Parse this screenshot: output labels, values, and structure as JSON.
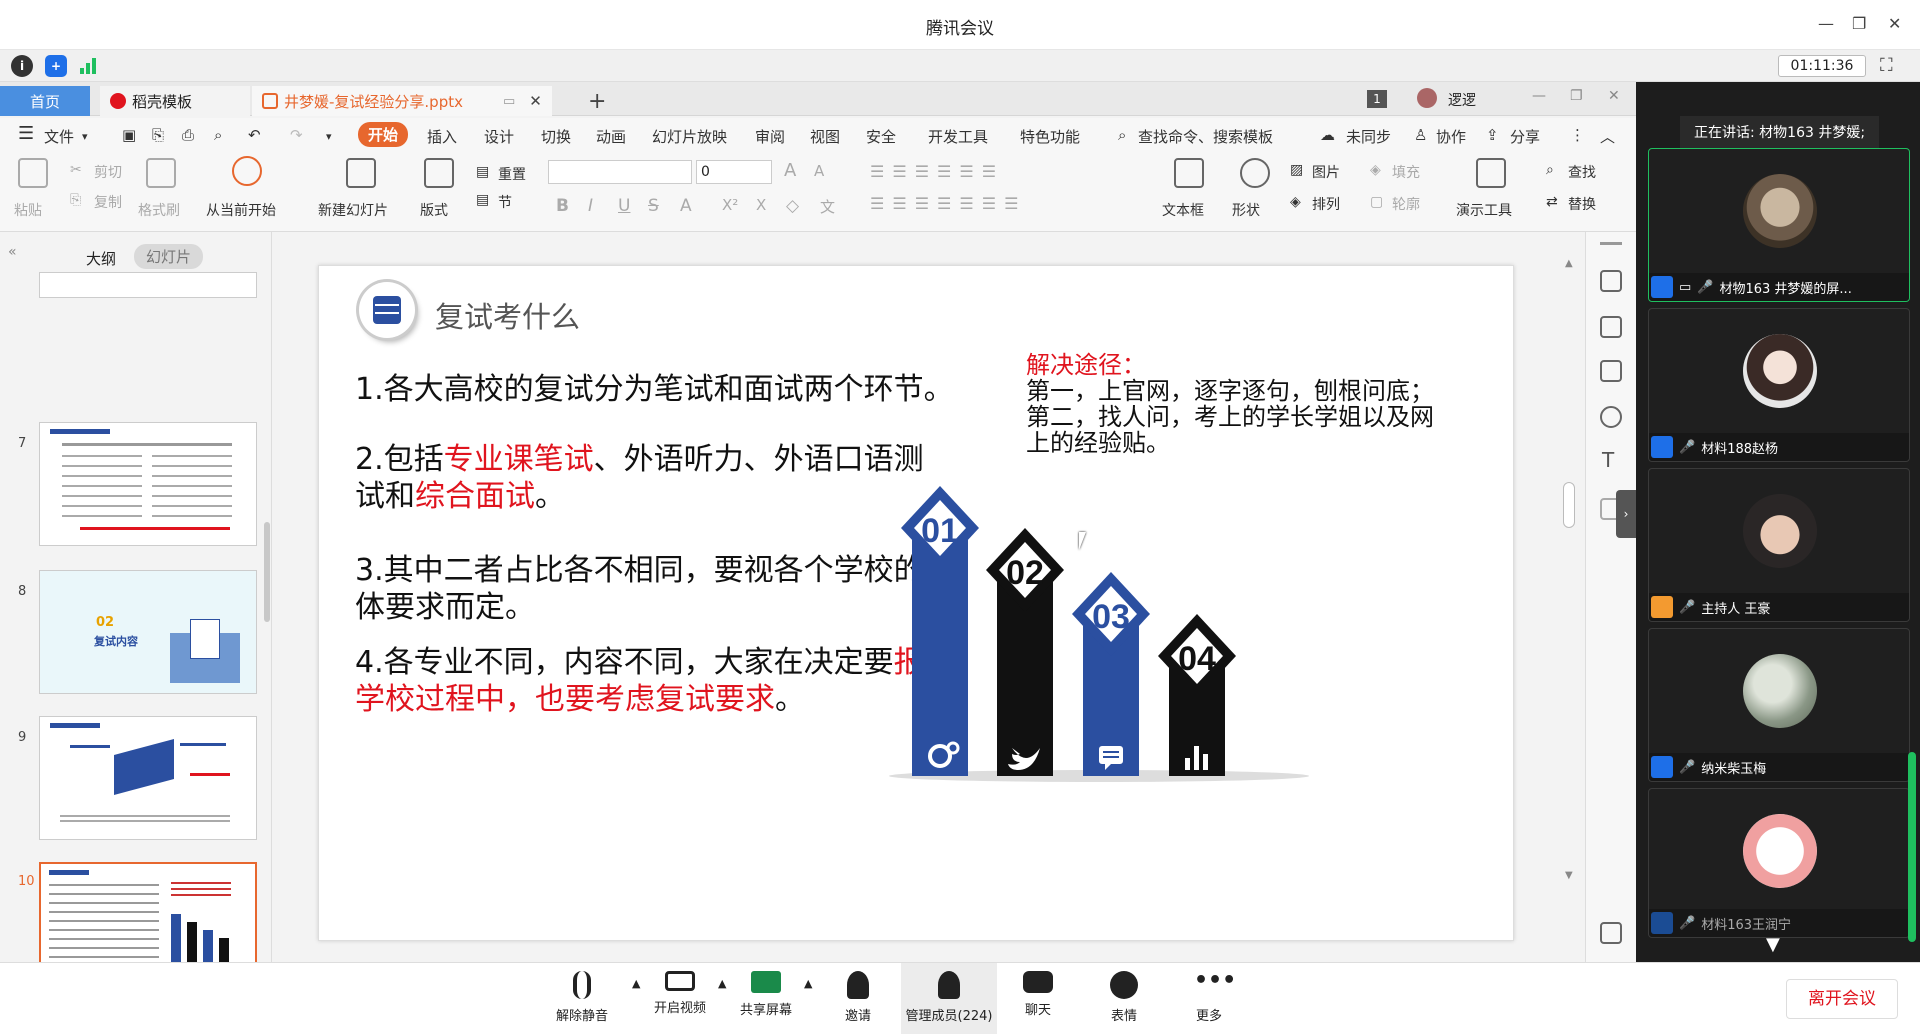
{
  "window": {
    "title": "腾讯会议",
    "timer": "01:11:36"
  },
  "wps_tabs": {
    "home": "首页",
    "daoke": "稻壳模板",
    "file": "井梦媛-复试经验分享.pptx",
    "add": "+",
    "badge": "1",
    "user": "逻逻"
  },
  "menu": {
    "file": "文件",
    "start": "开始",
    "insert": "插入",
    "design": "设计",
    "switch": "切换",
    "animation": "动画",
    "slideshow": "幻灯片放映",
    "review": "审阅",
    "view": "视图",
    "security": "安全",
    "devtools": "开发工具",
    "special": "特色功能",
    "search": "查找命令、搜索模板",
    "unsynced": "未同步",
    "collab": "协作",
    "share": "分享"
  },
  "ribbon": {
    "paste": "粘贴",
    "cut": "剪切",
    "copy": "复制",
    "format_painter": "格式刷",
    "play_from_current": "从当前开始",
    "new_slide": "新建幻灯片",
    "layout": "版式",
    "reset": "重置",
    "section": "节",
    "font_size": "0",
    "textbox": "文本框",
    "shape": "形状",
    "picture": "图片",
    "fill": "填充",
    "arrange": "排列",
    "outline": "轮廓",
    "present_tools": "演示工具",
    "find": "查找",
    "replace": "替换"
  },
  "leftpanel": {
    "outline_tab": "大纲",
    "slides_tab": "幻灯片",
    "thumbs": [
      {
        "num": "7"
      },
      {
        "num": "8"
      },
      {
        "num": "9"
      },
      {
        "num": "10"
      }
    ],
    "thumb8_num": "02",
    "thumb8_title": "复试内容"
  },
  "slide": {
    "title": "复试考什么",
    "p1": "1.各大高校的复试分为笔试和面试两个环节。",
    "p2_a": "2.包括",
    "p2_b": "专业课笔试",
    "p2_c": "、外语听力、外语口语测",
    "p2_d": "试和",
    "p2_e": "综合面试",
    "p2_f": "。",
    "p3_a": "3.其中二者占比各不相同，要视各个学校的具",
    "p3_b": "体要求而定。",
    "p4_a": "4.各专业不同，内容不同，大家在决定要",
    "p4_b": "报考",
    "p4_c": "学校过程中，也要考虑复试要求",
    "p4_d": "。",
    "solution_title": "解决途径：",
    "solution_1": "第一，上官网，逐字逐句，刨根问底；",
    "solution_2": "第二，找人问，考上的学长学姐以及网",
    "solution_3": "上的经验贴。",
    "steps": [
      "01",
      "02",
      "03",
      "04"
    ]
  },
  "participants": {
    "speaking": "正在讲话: 材物163 井梦媛;",
    "people": [
      {
        "name": "材物163 井梦媛的屏..."
      },
      {
        "name": "材料188赵杨"
      },
      {
        "name": "主持人 王豪"
      },
      {
        "name": "纳米柴玉梅"
      },
      {
        "name": "材料163王润宁"
      }
    ]
  },
  "bottom": {
    "unmute": "解除静音",
    "video": "开启视频",
    "share_screen": "共享屏幕",
    "invite": "邀请",
    "manage": "管理成员(224)",
    "chat": "聊天",
    "emoji": "表情",
    "more": "更多",
    "leave": "离开会议"
  },
  "colors": {
    "accent_orange": "#e7672e",
    "brand_blue": "#1e6fe8",
    "slide_blue": "#2b4fa0",
    "active_green": "#1fbf5f",
    "red_text": "#e0141e"
  }
}
